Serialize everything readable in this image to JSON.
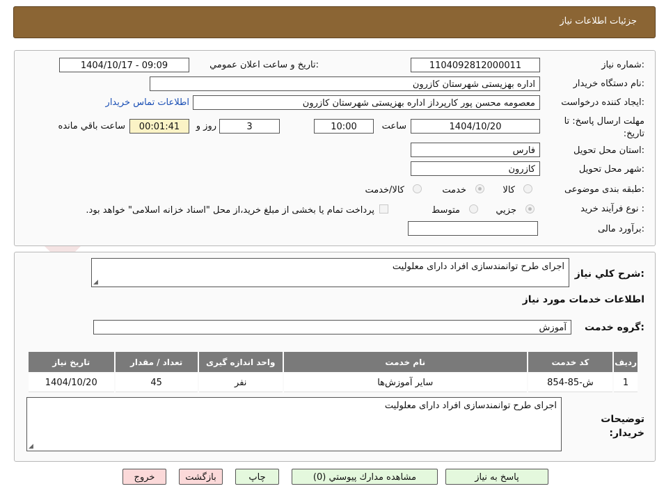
{
  "header": {
    "title": "جزئیات اطلاعات نیاز"
  },
  "form": {
    "need_number_label": "شماره نیاز:",
    "need_number_value": "1104092812000011",
    "announce_label": "تاریخ و ساعت اعلان عمومي:",
    "announce_value": "1404/10/17 - 09:09",
    "buyer_org_label": "نام دستگاه خریدار:",
    "buyer_org_value": "اداره بهزیستی شهرستان کازرون",
    "requester_label": "ایجاد کننده درخواست:",
    "requester_value": "معصومه محسن پور کارپرداز اداره بهزیستی شهرستان کازرون",
    "contact_link": "اطلاعات تماس خریدار",
    "deadline_label": "مهلت ارسال پاسخ: تا تاریخ:",
    "deadline_date": "1404/10/20",
    "time_label": "ساعت",
    "deadline_time": "10:00",
    "days_value": "3",
    "days_label": "روز و",
    "remaining_time": "00:01:41",
    "remaining_label": "ساعت باقي مانده",
    "province_label": "استان محل تحویل:",
    "province_value": "فارس",
    "city_label": "شهر محل تحویل:",
    "city_value": "کازرون",
    "category_label": "طبقه بندی موضوعی:",
    "category_options": [
      "کالا",
      "خدمت",
      "کالا/خدمت"
    ],
    "category_selected": "خدمت",
    "process_label": "نوع فرآیند خرید :",
    "process_options": [
      "جزیي",
      "متوسط"
    ],
    "process_selected": "جزیي",
    "payment_note": "پرداخت تمام یا بخشی از مبلغ خرید،از محل \"اسناد خزانه اسلامی\" خواهد بود.",
    "budget_label": "برآورد مالی:",
    "budget_value": ""
  },
  "need": {
    "summary_label": "شرح کلي نیاز:",
    "summary_value": "اجرای طرح توانمندسازی افراد دارای معلولیت",
    "services_title": "اطلاعات خدمات مورد نیاز",
    "service_group_label": "گروه خدمت:",
    "service_group_value": "آموزش"
  },
  "table": {
    "headers": [
      "ردیف",
      "کد خدمت",
      "نام خدمت",
      "واحد اندازه گیری",
      "تعداد / مقدار",
      "تاریخ نیاز"
    ],
    "rows": [
      [
        "1",
        "ش-85-854",
        "سایر آموزش‌ها",
        "نفر",
        "45",
        "1404/10/20"
      ]
    ]
  },
  "buyer_notes": {
    "label": "توضیحات خریدار:",
    "value": "اجرای طرح توانمندسازی افراد دارای معلولیت"
  },
  "buttons": {
    "reply": "پاسخ به نیاز",
    "attachments": "مشاهده مدارك پیوستي (0)",
    "print": "چاپ",
    "back": "بازگشت",
    "exit": "خروج"
  },
  "watermark": {
    "text": "AriaTender.net"
  },
  "colors": {
    "header_bg": "#8b6534",
    "table_header_bg": "#7a7a7a",
    "green_button": "#e4f8dd",
    "pink_button": "#fbd9d9",
    "link": "#1a4fb5"
  }
}
